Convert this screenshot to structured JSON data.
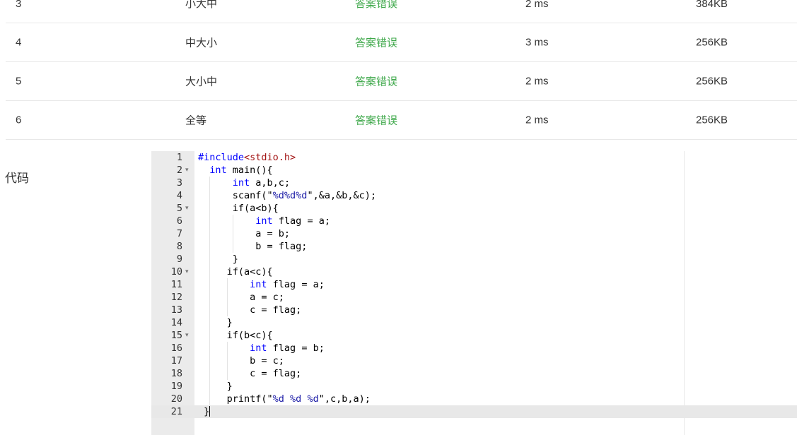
{
  "results": [
    {
      "id": "3",
      "name": "小大中",
      "status": "答案错误",
      "time": "2 ms",
      "memory": "384KB"
    },
    {
      "id": "4",
      "name": "中大小",
      "status": "答案错误",
      "time": "3 ms",
      "memory": "256KB"
    },
    {
      "id": "5",
      "name": "大小中",
      "status": "答案错误",
      "time": "2 ms",
      "memory": "256KB"
    },
    {
      "id": "6",
      "name": "全等",
      "status": "答案错误",
      "time": "2 ms",
      "memory": "256KB"
    }
  ],
  "code_section_label": "代码",
  "editor": {
    "active_line": 21,
    "lines": [
      {
        "n": "1",
        "fold": "",
        "code": "#include<stdio.h>"
      },
      {
        "n": "2",
        "fold": "▾",
        "code": "  int main(){"
      },
      {
        "n": "3",
        "fold": "",
        "code": "      int a,b,c;"
      },
      {
        "n": "4",
        "fold": "",
        "code": "      scanf(\"%d%d%d\",&a,&b,&c);"
      },
      {
        "n": "5",
        "fold": "▾",
        "code": "      if(a<b){"
      },
      {
        "n": "6",
        "fold": "",
        "code": "          int flag = a;"
      },
      {
        "n": "7",
        "fold": "",
        "code": "          a = b;"
      },
      {
        "n": "8",
        "fold": "",
        "code": "          b = flag;"
      },
      {
        "n": "9",
        "fold": "",
        "code": "      }"
      },
      {
        "n": "10",
        "fold": "▾",
        "code": "     if(a<c){"
      },
      {
        "n": "11",
        "fold": "",
        "code": "         int flag = a;"
      },
      {
        "n": "12",
        "fold": "",
        "code": "         a = c;"
      },
      {
        "n": "13",
        "fold": "",
        "code": "         c = flag;"
      },
      {
        "n": "14",
        "fold": "",
        "code": "     }"
      },
      {
        "n": "15",
        "fold": "▾",
        "code": "     if(b<c){"
      },
      {
        "n": "16",
        "fold": "",
        "code": "         int flag = b;"
      },
      {
        "n": "17",
        "fold": "",
        "code": "         b = c;"
      },
      {
        "n": "18",
        "fold": "",
        "code": "         c = flag;"
      },
      {
        "n": "19",
        "fold": "",
        "code": "     }"
      },
      {
        "n": "20",
        "fold": "",
        "code": "     printf(\"%d %d %d\",c,b,a);"
      },
      {
        "n": "21",
        "fold": "",
        "code": " }"
      }
    ]
  }
}
